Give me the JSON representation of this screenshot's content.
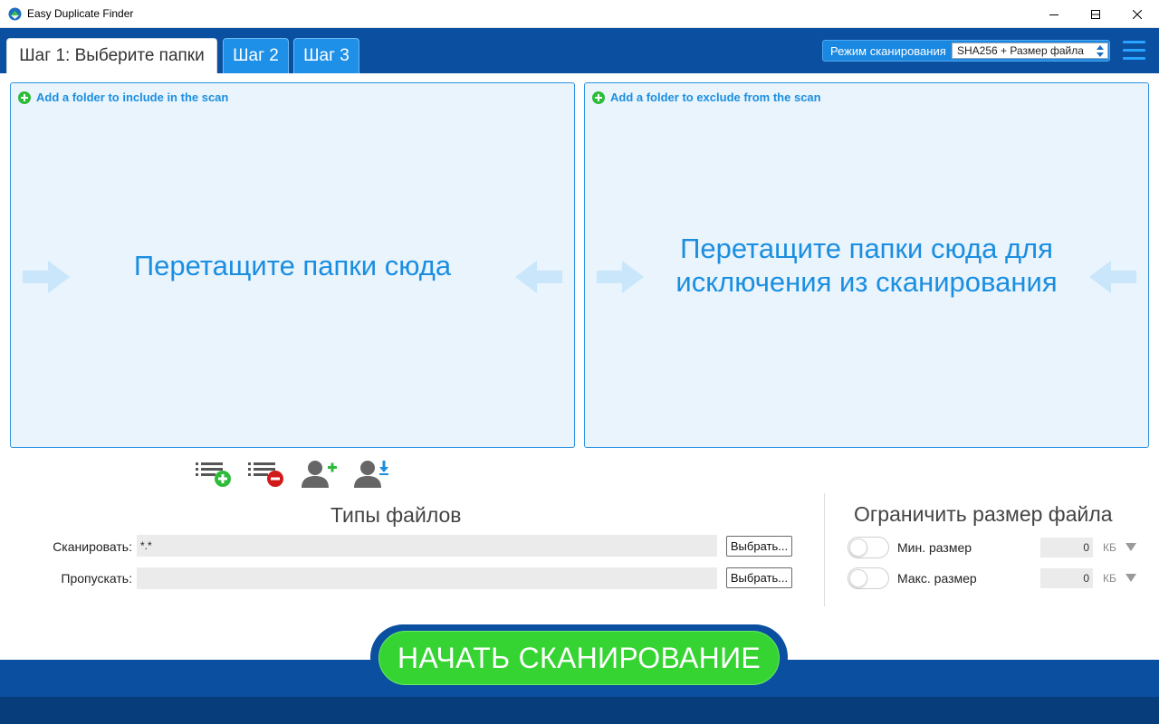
{
  "window": {
    "title": "Easy Duplicate Finder"
  },
  "tabs": [
    {
      "label": "Шаг 1: Выберите папки",
      "active": true
    },
    {
      "label": "Шаг 2",
      "active": false
    },
    {
      "label": "Шаг 3",
      "active": false
    }
  ],
  "scan_mode": {
    "label": "Режим сканирования",
    "selected": "SHA256 + Размер файла"
  },
  "include_panel": {
    "add_label": "Add a folder to include in the scan",
    "drop_text": "Перетащите папки сюда"
  },
  "exclude_panel": {
    "add_label": "Add a folder to exclude from the scan",
    "drop_text": "Перетащите папки сюда для исключения из сканирования"
  },
  "file_types": {
    "title": "Типы файлов",
    "scan_label": "Сканировать:",
    "scan_value": "*.*",
    "skip_label": "Пропускать:",
    "skip_value": "",
    "choose_label": "Выбрать..."
  },
  "size_limit": {
    "title": "Ограничить размер файла",
    "min_label": "Мин. размер",
    "min_value": "0",
    "min_enabled": false,
    "max_label": "Макс. размер",
    "max_value": "0",
    "max_enabled": false,
    "unit": "КБ"
  },
  "start_button": {
    "label": "НАЧАТЬ СКАНИРОВАНИЕ"
  },
  "icons": {
    "toolbar": [
      "list-add-icon",
      "list-remove-icon",
      "user-add-icon",
      "user-download-icon"
    ]
  },
  "colors": {
    "header_blue": "#0a4fa0",
    "accent_blue": "#1b8ee0",
    "panel_bg": "#e9f4fd",
    "start_green": "#35d432"
  }
}
